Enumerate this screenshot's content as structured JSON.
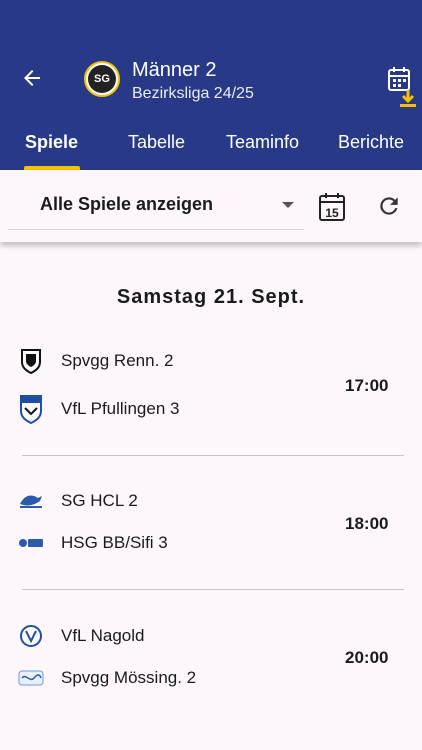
{
  "header": {
    "title": "Männer 2",
    "subtitle": "Bezirksliga 24/25",
    "club_logo_text": "SG",
    "accent_color": "#f2c200",
    "bar_color": "#283a87"
  },
  "tabs": [
    {
      "label": "Spiele",
      "active": true
    },
    {
      "label": "Tabelle",
      "active": false
    },
    {
      "label": "Teaminfo",
      "active": false
    },
    {
      "label": "Berichte",
      "active": false
    }
  ],
  "filter": {
    "selected": "Alle Spiele anzeigen",
    "calendar_day": "15"
  },
  "day": "Samstag 21. Sept.",
  "matches": [
    {
      "home": "Spvgg Renn. 2",
      "away": "VfL Pfullingen 3",
      "time": "17:00",
      "home_icon": "shield-icon",
      "away_icon": "crest-icon"
    },
    {
      "home": "SG HCL 2",
      "away": "HSG BB/Sifi 3",
      "time": "18:00",
      "home_icon": "hcl-logo-icon",
      "away_icon": "hsg-logo-icon"
    },
    {
      "home": "VfL Nagold",
      "away": "Spvgg Mössing. 2",
      "time": "20:00",
      "home_icon": "nagold-logo-icon",
      "away_icon": "moessingen-logo-icon"
    }
  ]
}
